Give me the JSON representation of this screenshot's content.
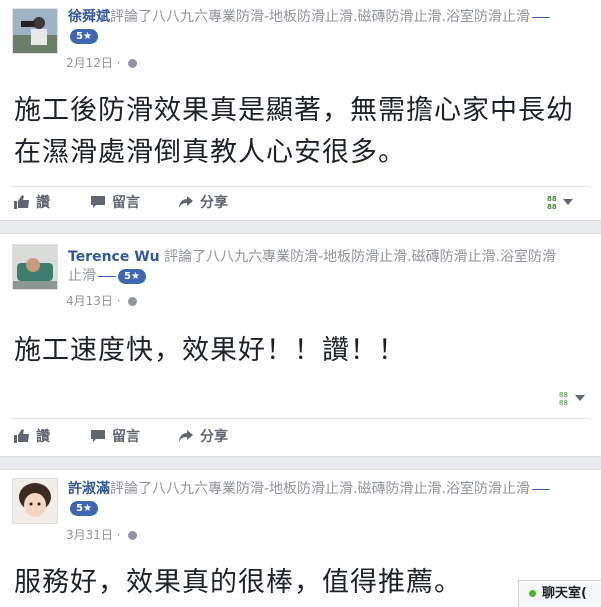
{
  "reviews": [
    {
      "author": "徐舜斌",
      "action_text": "評論了八八九六專業防滑-地板防滑止滑.磁磚防滑止滑.浴室防滑止滑",
      "rating": "5★",
      "date": "2月12日",
      "body": "施工後防滑效果真是顯著，無需擔心家中長幼在濕滑處滑倒真教人心安很多。"
    },
    {
      "author": "Terence Wu",
      "action_text": "評論了八八九六專業防滑-地板防滑止滑.磁磚防滑止滑.浴室防滑止滑",
      "rating": "5★",
      "date": "4月13日",
      "body": "施工速度快，效果好！！讚！！"
    },
    {
      "author": "許淑滿",
      "action_text": "評論了八八九六專業防滑-地板防滑止滑.磁磚防滑止滑.浴室防滑止滑",
      "rating": "5★",
      "date": "3月31日",
      "body": "服務好，效果真的很棒，值得推薦。"
    }
  ],
  "actions": {
    "like": "讚",
    "comment": "留言",
    "share": "分享"
  },
  "chat": {
    "label": "聊天室("
  },
  "colors": {
    "link": "#365899",
    "badge": "#4267b2",
    "separator": "#e9ebee"
  }
}
